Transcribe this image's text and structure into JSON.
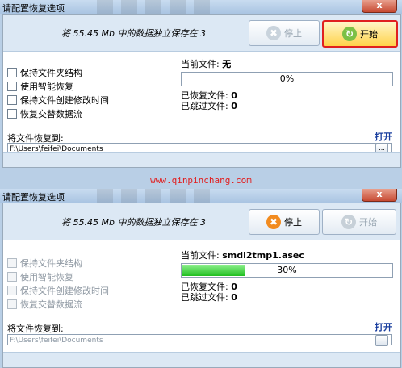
{
  "watermark": "www.qinpinchang.com",
  "dialogs": [
    {
      "title": "请配置恢复选项",
      "close": "x",
      "save_info": "将 55.45 Mb 中的数据独立保存在 3",
      "stop_label": "停止",
      "start_label": "开始",
      "options": [
        "保持文件夹结构",
        "使用智能恢复",
        "保持文件创建修改时间",
        "恢复交替数据流"
      ],
      "current_file_label": "当前文件:",
      "current_file": "无",
      "progress_text": "0%",
      "progress": 0,
      "recovered_label": "已恢复文件:",
      "recovered": "0",
      "skipped_label": "已跳过文件:",
      "skipped": "0",
      "destination_label": "将文件恢复到:",
      "open_label": "打开",
      "path": "F:\\Users\\feifei\\Documents",
      "browse": "..."
    },
    {
      "title": "请配置恢复选项",
      "close": "x",
      "save_info": "将 55.45 Mb 中的数据独立保存在 3",
      "stop_label": "停止",
      "start_label": "开始",
      "options": [
        "保持文件夹结构",
        "使用智能恢复",
        "保持文件创建修改时间",
        "恢复交替数据流"
      ],
      "current_file_label": "当前文件:",
      "current_file": "smdl2tmp1.asec",
      "progress_text": "30%",
      "progress": 0.3,
      "recovered_label": "已恢复文件:",
      "recovered": "0",
      "skipped_label": "已跳过文件:",
      "skipped": "0",
      "destination_label": "将文件恢复到:",
      "open_label": "打开",
      "path": "F:\\Users\\feifei\\Documents",
      "browse": "..."
    }
  ]
}
